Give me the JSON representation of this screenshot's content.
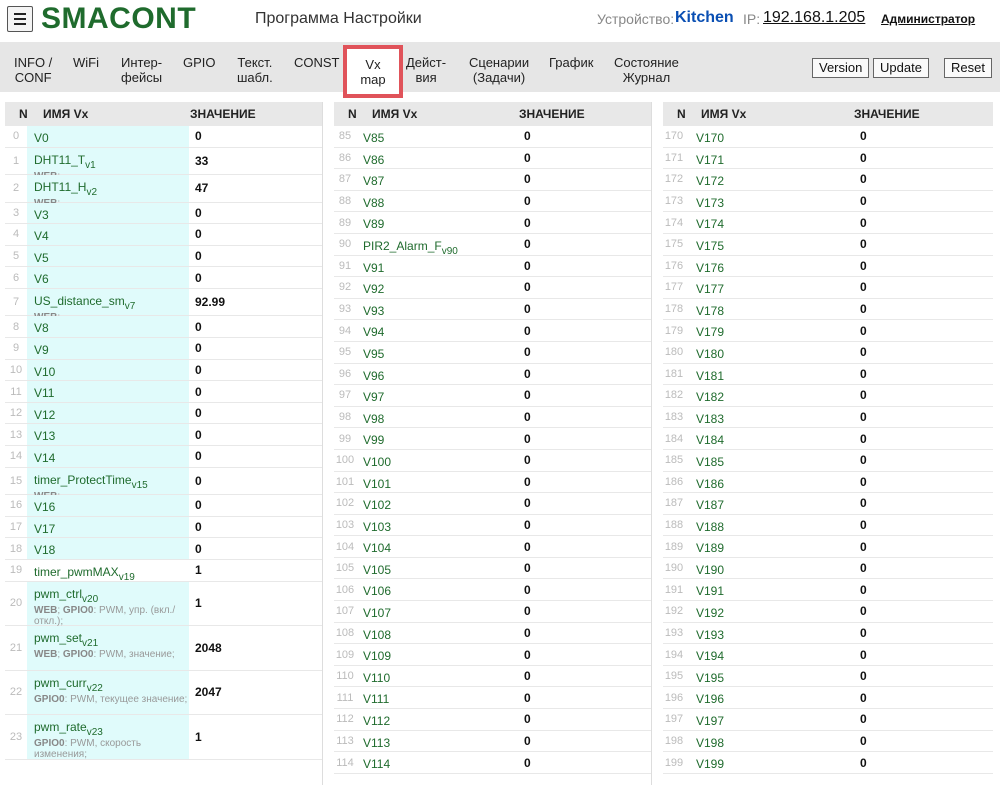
{
  "header": {
    "logo": "SMACONT",
    "program_title": "Программа Настройки",
    "device_label": "Устройство:",
    "device_name": "Kitchen",
    "ip_label": "IP:",
    "ip_value": "192.168.1.205",
    "user": "Администратор"
  },
  "nav": {
    "tabs": [
      {
        "line1": "INFO /",
        "line2": "CONF"
      },
      {
        "line1": "WiFi",
        "line2": ""
      },
      {
        "line1": "Интер-",
        "line2": "фейсы"
      },
      {
        "line1": "GPIO",
        "line2": ""
      },
      {
        "line1": "Текст.",
        "line2": "шабл."
      },
      {
        "line1": "CONST",
        "line2": ""
      },
      {
        "line1": "Vx",
        "line2": "map"
      },
      {
        "line1": "Дейст-",
        "line2": "вия"
      },
      {
        "line1": "Сценарии",
        "line2": "(Задачи)"
      },
      {
        "line1": "График",
        "line2": ""
      },
      {
        "line1": "Состояние",
        "line2": "Журнал"
      }
    ],
    "buttons": {
      "version": "Version",
      "update": "Update",
      "reset": "Reset"
    }
  },
  "table_headers": {
    "n": "N",
    "name": "ИМЯ Vx",
    "value": "ЗНАЧЕНИЕ"
  },
  "col1": [
    {
      "n": "0",
      "name": "V0",
      "value": "0"
    },
    {
      "n": "1",
      "name": "DHT11_T",
      "sub": "v1",
      "desc": [
        [
          "WEB",
          ";"
        ]
      ],
      "value": "33"
    },
    {
      "n": "2",
      "name": "DHT11_H",
      "sub": "v2",
      "desc": [
        [
          "WEB",
          ";"
        ]
      ],
      "value": "47"
    },
    {
      "n": "3",
      "name": "V3",
      "value": "0"
    },
    {
      "n": "4",
      "name": "V4",
      "value": "0"
    },
    {
      "n": "5",
      "name": "V5",
      "value": "0"
    },
    {
      "n": "6",
      "name": "V6",
      "value": "0"
    },
    {
      "n": "7",
      "name": "US_distance_sm",
      "sub": "v7",
      "desc": [
        [
          "WEB",
          ";"
        ]
      ],
      "value": "92.99"
    },
    {
      "n": "8",
      "name": "V8",
      "value": "0"
    },
    {
      "n": "9",
      "name": "V9",
      "value": "0"
    },
    {
      "n": "10",
      "name": "V10",
      "value": "0"
    },
    {
      "n": "11",
      "name": "V11",
      "value": "0"
    },
    {
      "n": "12",
      "name": "V12",
      "value": "0"
    },
    {
      "n": "13",
      "name": "V13",
      "value": "0"
    },
    {
      "n": "14",
      "name": "V14",
      "value": "0"
    },
    {
      "n": "15",
      "name": "timer_ProtectTime",
      "sub": "v15",
      "desc": [
        [
          "WEB",
          ";"
        ]
      ],
      "value": "0"
    },
    {
      "n": "16",
      "name": "V16",
      "value": "0"
    },
    {
      "n": "17",
      "name": "V17",
      "value": "0"
    },
    {
      "n": "18",
      "name": "V18",
      "value": "0"
    },
    {
      "n": "19",
      "name": "timer_pwmMAX",
      "sub": "v19",
      "value": "1",
      "plain": true
    },
    {
      "n": "20",
      "name": "pwm_ctrl",
      "sub": "v20",
      "desc": [
        [
          "WEB",
          "; "
        ],
        [
          "GPIO0",
          ": PWM, упр. (вкл./откл.);"
        ]
      ],
      "value": "1"
    },
    {
      "n": "21",
      "name": "pwm_set",
      "sub": "v21",
      "desc": [
        [
          "WEB",
          "; "
        ],
        [
          "GPIO0",
          ": PWM, значение;"
        ]
      ],
      "value": "2048"
    },
    {
      "n": "22",
      "name": "pwm_curr",
      "sub": "v22",
      "desc": [
        [
          "GPIO0",
          ": PWM, текущее значение;"
        ]
      ],
      "value": "2047"
    },
    {
      "n": "23",
      "name": "pwm_rate",
      "sub": "v23",
      "desc": [
        [
          "GPIO0",
          ": PWM, скорость изменения;"
        ]
      ],
      "value": "1"
    }
  ],
  "col2": [
    {
      "n": "85",
      "name": "V85",
      "value": "0"
    },
    {
      "n": "86",
      "name": "V86",
      "value": "0"
    },
    {
      "n": "87",
      "name": "V87",
      "value": "0"
    },
    {
      "n": "88",
      "name": "V88",
      "value": "0"
    },
    {
      "n": "89",
      "name": "V89",
      "value": "0"
    },
    {
      "n": "90",
      "name": "PIR2_Alarm_F",
      "sub": "v90",
      "value": "0"
    },
    {
      "n": "91",
      "name": "V91",
      "value": "0"
    },
    {
      "n": "92",
      "name": "V92",
      "value": "0"
    },
    {
      "n": "93",
      "name": "V93",
      "value": "0"
    },
    {
      "n": "94",
      "name": "V94",
      "value": "0"
    },
    {
      "n": "95",
      "name": "V95",
      "value": "0"
    },
    {
      "n": "96",
      "name": "V96",
      "value": "0"
    },
    {
      "n": "97",
      "name": "V97",
      "value": "0"
    },
    {
      "n": "98",
      "name": "V98",
      "value": "0"
    },
    {
      "n": "99",
      "name": "V99",
      "value": "0"
    },
    {
      "n": "100",
      "name": "V100",
      "value": "0"
    },
    {
      "n": "101",
      "name": "V101",
      "value": "0"
    },
    {
      "n": "102",
      "name": "V102",
      "value": "0"
    },
    {
      "n": "103",
      "name": "V103",
      "value": "0"
    },
    {
      "n": "104",
      "name": "V104",
      "value": "0"
    },
    {
      "n": "105",
      "name": "V105",
      "value": "0"
    },
    {
      "n": "106",
      "name": "V106",
      "value": "0"
    },
    {
      "n": "107",
      "name": "V107",
      "value": "0"
    },
    {
      "n": "108",
      "name": "V108",
      "value": "0"
    },
    {
      "n": "109",
      "name": "V109",
      "value": "0"
    },
    {
      "n": "110",
      "name": "V110",
      "value": "0"
    },
    {
      "n": "111",
      "name": "V111",
      "value": "0"
    },
    {
      "n": "112",
      "name": "V112",
      "value": "0"
    },
    {
      "n": "113",
      "name": "V113",
      "value": "0"
    },
    {
      "n": "114",
      "name": "V114",
      "value": "0"
    }
  ],
  "col3": [
    {
      "n": "170",
      "name": "V170",
      "value": "0"
    },
    {
      "n": "171",
      "name": "V171",
      "value": "0"
    },
    {
      "n": "172",
      "name": "V172",
      "value": "0"
    },
    {
      "n": "173",
      "name": "V173",
      "value": "0"
    },
    {
      "n": "174",
      "name": "V174",
      "value": "0"
    },
    {
      "n": "175",
      "name": "V175",
      "value": "0"
    },
    {
      "n": "176",
      "name": "V176",
      "value": "0"
    },
    {
      "n": "177",
      "name": "V177",
      "value": "0"
    },
    {
      "n": "178",
      "name": "V178",
      "value": "0"
    },
    {
      "n": "179",
      "name": "V179",
      "value": "0"
    },
    {
      "n": "180",
      "name": "V180",
      "value": "0"
    },
    {
      "n": "181",
      "name": "V181",
      "value": "0"
    },
    {
      "n": "182",
      "name": "V182",
      "value": "0"
    },
    {
      "n": "183",
      "name": "V183",
      "value": "0"
    },
    {
      "n": "184",
      "name": "V184",
      "value": "0"
    },
    {
      "n": "185",
      "name": "V185",
      "value": "0"
    },
    {
      "n": "186",
      "name": "V186",
      "value": "0"
    },
    {
      "n": "187",
      "name": "V187",
      "value": "0"
    },
    {
      "n": "188",
      "name": "V188",
      "value": "0"
    },
    {
      "n": "189",
      "name": "V189",
      "value": "0"
    },
    {
      "n": "190",
      "name": "V190",
      "value": "0"
    },
    {
      "n": "191",
      "name": "V191",
      "value": "0"
    },
    {
      "n": "192",
      "name": "V192",
      "value": "0"
    },
    {
      "n": "193",
      "name": "V193",
      "value": "0"
    },
    {
      "n": "194",
      "name": "V194",
      "value": "0"
    },
    {
      "n": "195",
      "name": "V195",
      "value": "0"
    },
    {
      "n": "196",
      "name": "V196",
      "value": "0"
    },
    {
      "n": "197",
      "name": "V197",
      "value": "0"
    },
    {
      "n": "198",
      "name": "V198",
      "value": "0"
    },
    {
      "n": "199",
      "name": "V199",
      "value": "0"
    }
  ]
}
